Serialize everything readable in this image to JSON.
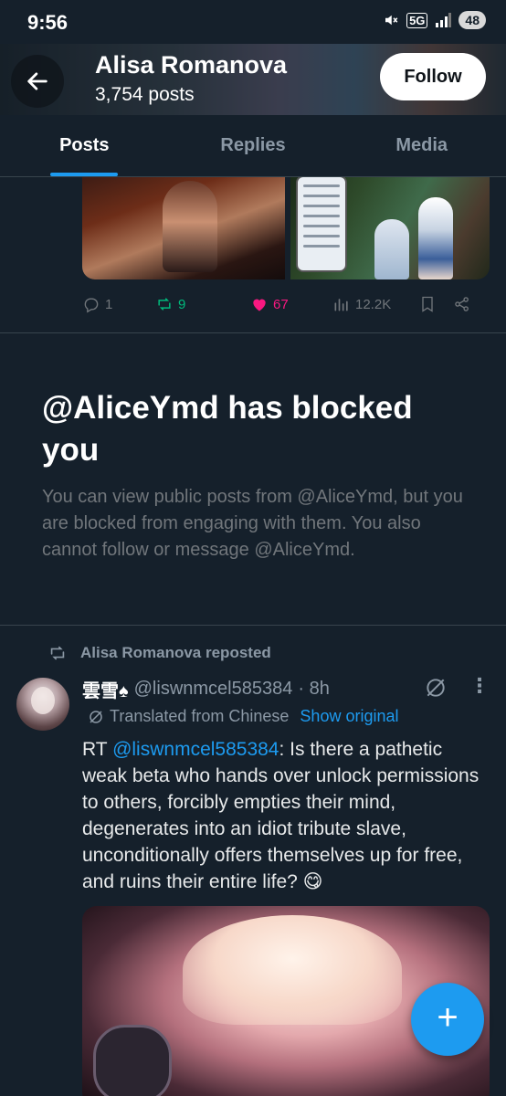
{
  "status_bar": {
    "time": "9:56",
    "network": "5G",
    "battery": "48"
  },
  "profile_header": {
    "name": "Alisa Romanova",
    "posts_count": "3,754 posts",
    "follow_label": "Follow"
  },
  "tabs": [
    {
      "label": "Posts",
      "active": true
    },
    {
      "label": "Replies",
      "active": false
    },
    {
      "label": "Media",
      "active": false
    }
  ],
  "previous_post": {
    "replies": "1",
    "reposts": "9",
    "likes": "67",
    "views": "12.2K"
  },
  "blocked_notice": {
    "title": "@AliceYmd has blocked you",
    "body": "You can view public posts from @AliceYmd, but you are blocked from engaging with them. You also cannot follow or message @AliceYmd."
  },
  "repost": {
    "label": "Alisa Romanova reposted",
    "author_name": "雲雪♠",
    "handle": "@liswnmcel585384",
    "time": "· 8h",
    "translated_label": "Translated from Chinese",
    "show_original_label": "Show original",
    "text_prefix": "RT ",
    "mention": "@liswnmcel585384",
    "text_body": ": Is there a pathetic weak beta who hands over unlock permissions to others, forcibly empties their mind, degenerates into an idiot tribute slave, unconditionally offers themselves up for free, and ruins their entire life? 😋"
  },
  "colors": {
    "background": "#15202b",
    "accent": "#1d9bf0",
    "like": "#f91880",
    "repost": "#00ba7c"
  },
  "icons": [
    "back-arrow-icon",
    "reply-icon",
    "repost-icon",
    "like-icon",
    "views-icon",
    "bookmark-icon",
    "share-icon",
    "grok-icon",
    "more-icon",
    "compose-icon"
  ]
}
